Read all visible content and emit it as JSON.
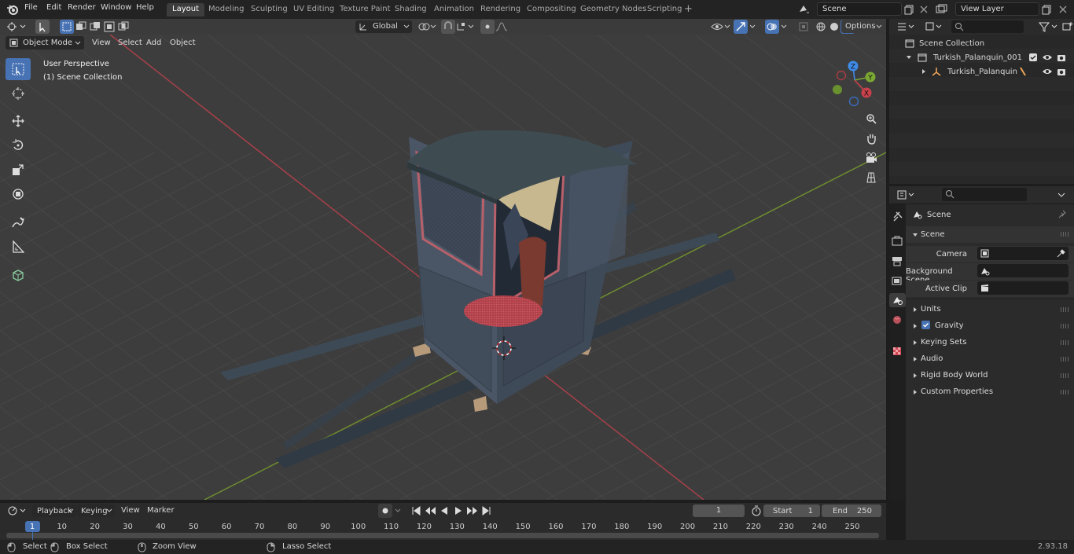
{
  "menus": {
    "file": "File",
    "edit": "Edit",
    "render": "Render",
    "window": "Window",
    "help": "Help"
  },
  "workspaces": [
    "Layout",
    "Modeling",
    "Sculpting",
    "UV Editing",
    "Texture Paint",
    "Shading",
    "Animation",
    "Rendering",
    "Compositing",
    "Geometry Nodes",
    "Scripting"
  ],
  "active_workspace": "Layout",
  "scene_field": "Scene",
  "view_layer_field": "View Layer",
  "viewport": {
    "mode": "Object Mode",
    "menus": {
      "view": "View",
      "select": "Select",
      "add": "Add",
      "object": "Object"
    },
    "orientation": "Global",
    "options": "Options",
    "overlay_line1": "User Perspective",
    "overlay_line2": "(1) Scene Collection",
    "gizmo": {
      "z": "Z",
      "y": "Y",
      "x": "X"
    }
  },
  "outliner": {
    "root": "Scene Collection",
    "items": [
      {
        "label": "Turkish_Palanquin_001"
      },
      {
        "label": "Turkish_Palanquin"
      }
    ]
  },
  "properties": {
    "header": "Scene",
    "section": "Scene",
    "fields": [
      {
        "label": "Camera"
      },
      {
        "label": "Background Scene"
      },
      {
        "label": "Active Clip"
      }
    ],
    "panels": [
      "Units",
      "Gravity",
      "Keying Sets",
      "Audio",
      "Rigid Body World",
      "Custom Properties"
    ]
  },
  "timeline": {
    "menus": {
      "playback": "Playback",
      "keying": "Keying",
      "view": "View",
      "marker": "Marker"
    },
    "current_frame": "1",
    "start_label": "Start",
    "start": "1",
    "end_label": "End",
    "end": "250",
    "ticks": [
      "1",
      "10",
      "20",
      "30",
      "40",
      "50",
      "60",
      "70",
      "80",
      "90",
      "100",
      "110",
      "120",
      "130",
      "140",
      "150",
      "160",
      "170",
      "180",
      "190",
      "200",
      "210",
      "220",
      "230",
      "240",
      "250"
    ]
  },
  "status": {
    "select": "Select",
    "box_select": "Box Select",
    "zoom_view": "Zoom View",
    "lasso_select": "Lasso Select",
    "version": "2.93.18"
  },
  "colors": {
    "accent": "#4772b3",
    "x_axis": "#c8414b",
    "y_axis": "#7ba833",
    "z_axis": "#3f8be8"
  }
}
